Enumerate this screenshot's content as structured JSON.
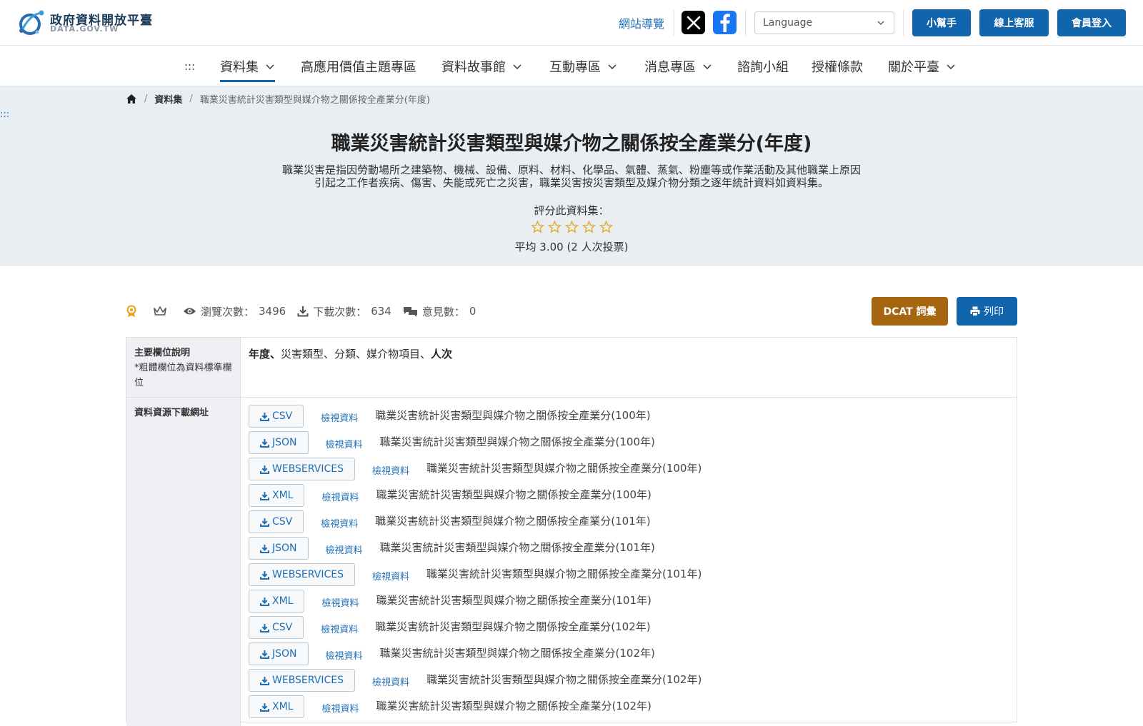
{
  "header": {
    "logo_title": "政府資料開放平臺",
    "logo_sub": "DATA.GOV.TW",
    "site_nav": "網站導覽",
    "language_placeholder": "Language",
    "helper": "小幫手",
    "online_service": "線上客服",
    "login": "會員登入"
  },
  "nav": {
    "skip": ":::",
    "items": [
      "資料集",
      "高應用價值主題專區",
      "資料故事館",
      "互動專區",
      "消息專區",
      "諮詢小組",
      "授權條款",
      "關於平臺"
    ]
  },
  "breadcrumb": {
    "datasets": "資料集",
    "current": "職業災害統計災害類型與媒介物之關係按全產業分(年度)"
  },
  "side_skip": ":::",
  "dataset": {
    "title": "職業災害統計災害類型與媒介物之關係按全產業分(年度)",
    "description": "職業災害是指因勞動場所之建築物、機械、設備、原料、材料、化學品、氣體、蒸氣、粉塵等或作業活動及其他職業上原因引起之工作者疾病、傷害、失能或死亡之災害，職業災害按災害類型及媒介物分類之逐年統計資料如資料集。",
    "rate_label": "評分此資料集：",
    "rating_value": 0,
    "rating_max": 5,
    "average": "平均 3.00 (2 人次投票)"
  },
  "stats": {
    "views_label": "瀏覽次數：",
    "views": "3496",
    "downloads_label": "下載次數：",
    "downloads": "634",
    "comments_label": "意見數：",
    "comments": "0"
  },
  "actions": {
    "dcat": "DCAT 詞彙",
    "print": "列印"
  },
  "table": {
    "fields_header": "主要欄位說明",
    "fields_note": "*粗體欄位為資料標準欄位",
    "fields_bold_1": "年度",
    "fields_sep_1": "、",
    "fields_plain": "災害類型、分類、媒介物項目、",
    "fields_bold_2": "人次",
    "resources_header": "資料資源下載網址",
    "view_label": "檢視資料",
    "resources": [
      {
        "format": "CSV",
        "name": "職業災害統計災害類型與媒介物之關係按全產業分(100年)"
      },
      {
        "format": "JSON",
        "name": "職業災害統計災害類型與媒介物之關係按全產業分(100年)"
      },
      {
        "format": "WEBSERVICES",
        "name": "職業災害統計災害類型與媒介物之關係按全產業分(100年)"
      },
      {
        "format": "XML",
        "name": "職業災害統計災害類型與媒介物之關係按全產業分(100年)"
      },
      {
        "format": "CSV",
        "name": "職業災害統計災害類型與媒介物之關係按全產業分(101年)"
      },
      {
        "format": "JSON",
        "name": "職業災害統計災害類型與媒介物之關係按全產業分(101年)"
      },
      {
        "format": "WEBSERVICES",
        "name": "職業災害統計災害類型與媒介物之關係按全產業分(101年)"
      },
      {
        "format": "XML",
        "name": "職業災害統計災害類型與媒介物之關係按全產業分(101年)"
      },
      {
        "format": "CSV",
        "name": "職業災害統計災害類型與媒介物之關係按全產業分(102年)"
      },
      {
        "format": "JSON",
        "name": "職業災害統計災害類型與媒介物之關係按全產業分(102年)"
      },
      {
        "format": "WEBSERVICES",
        "name": "職業災害統計災害類型與媒介物之關係按全產業分(102年)"
      },
      {
        "format": "XML",
        "name": "職業災害統計災害類型與媒介物之關係按全產業分(102年)"
      }
    ]
  },
  "colors": {
    "primary": "#1165ad",
    "dcat": "#a6660f",
    "hero_bg": "#e9eef3",
    "star": "#e8a317"
  }
}
